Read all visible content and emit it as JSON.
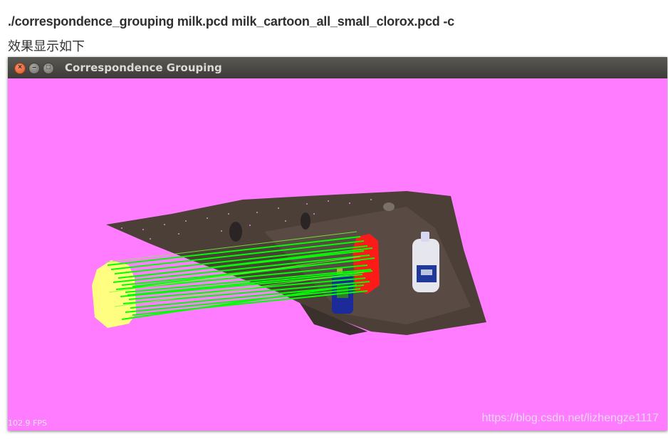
{
  "header": {
    "command": "./correspondence_grouping milk.pcd milk_cartoon_all_small_clorox.pcd -c",
    "caption": "效果显示如下"
  },
  "window": {
    "title": "Correspondence Grouping",
    "controls": [
      "close",
      "minimize",
      "maximize"
    ]
  },
  "viewport": {
    "background_color": "#ff7bff",
    "fps_text": "102.9 FPS",
    "watermark": "https://blog.csdn.net/lizhengze1117",
    "colors": {
      "model_cloud": "#ffff80",
      "correspondence_lines": "#00ff00",
      "instance_highlight": "#ff0000"
    }
  }
}
